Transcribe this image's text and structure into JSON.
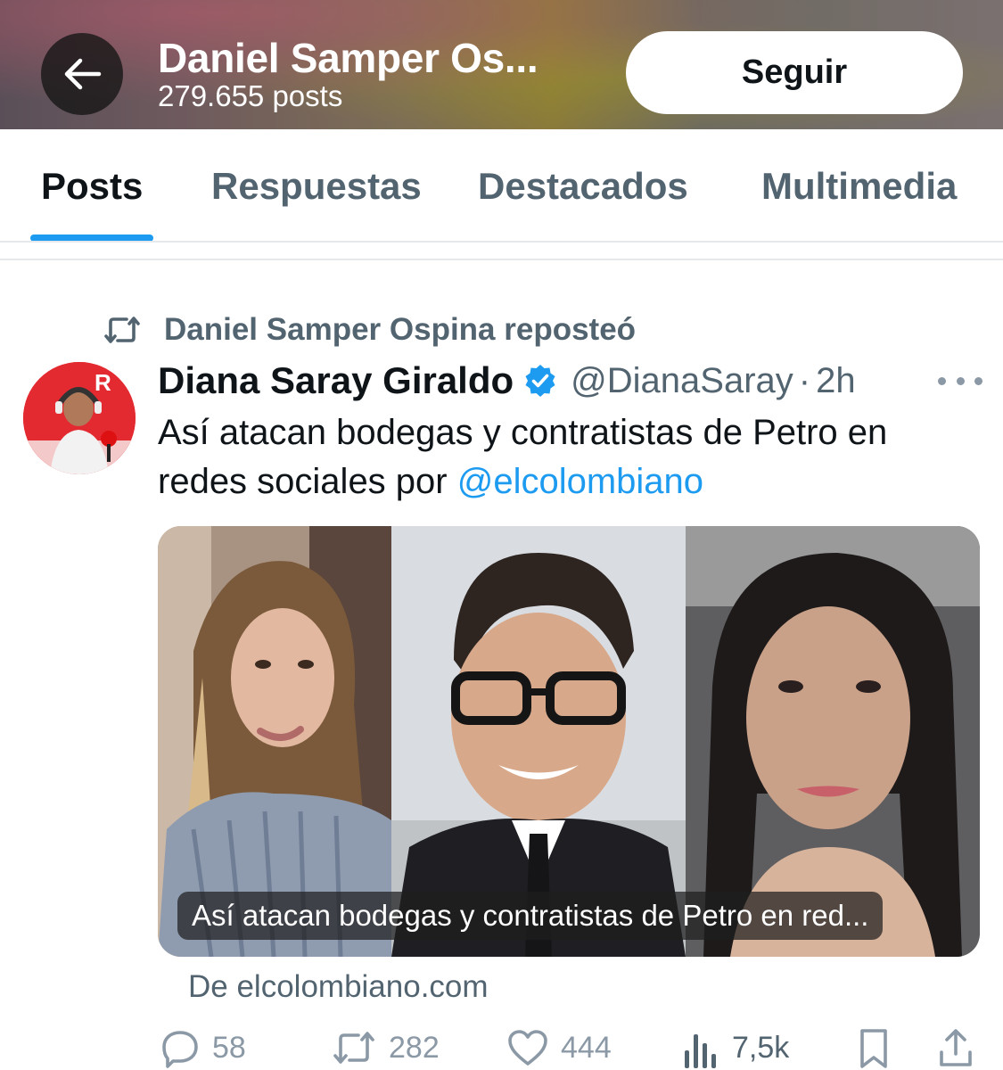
{
  "header": {
    "back_icon": "arrow-left-icon",
    "title": "Daniel Samper Os...",
    "posts_count": "279.655 posts",
    "follow_label": "Seguir"
  },
  "tabs": [
    {
      "label": "Posts",
      "active": true
    },
    {
      "label": "Respuestas",
      "active": false
    },
    {
      "label": "Destacados",
      "active": false
    },
    {
      "label": "Multimedia",
      "active": false
    }
  ],
  "post": {
    "repost_icon": "repost-icon",
    "repost_text": "Daniel Samper Ospina reposteó",
    "author_name": "Diana Saray Giraldo",
    "verified_icon": "verified-badge-icon",
    "handle": "@DianaSaray",
    "separator": "·",
    "time": "2h",
    "text_before": "Así atacan bodegas y contratistas de Petro en redes sociales por ",
    "mention": "@elcolombiano",
    "card_caption": "Así atacan bodegas y contratistas de Petro en red...",
    "source": "De elcolombiano.com",
    "actions": {
      "replies": "58",
      "reposts": "282",
      "likes": "444",
      "views": "7,5k"
    }
  },
  "colors": {
    "accent": "#1d9bf0",
    "text_primary": "#0f1419",
    "text_secondary": "#536471"
  }
}
